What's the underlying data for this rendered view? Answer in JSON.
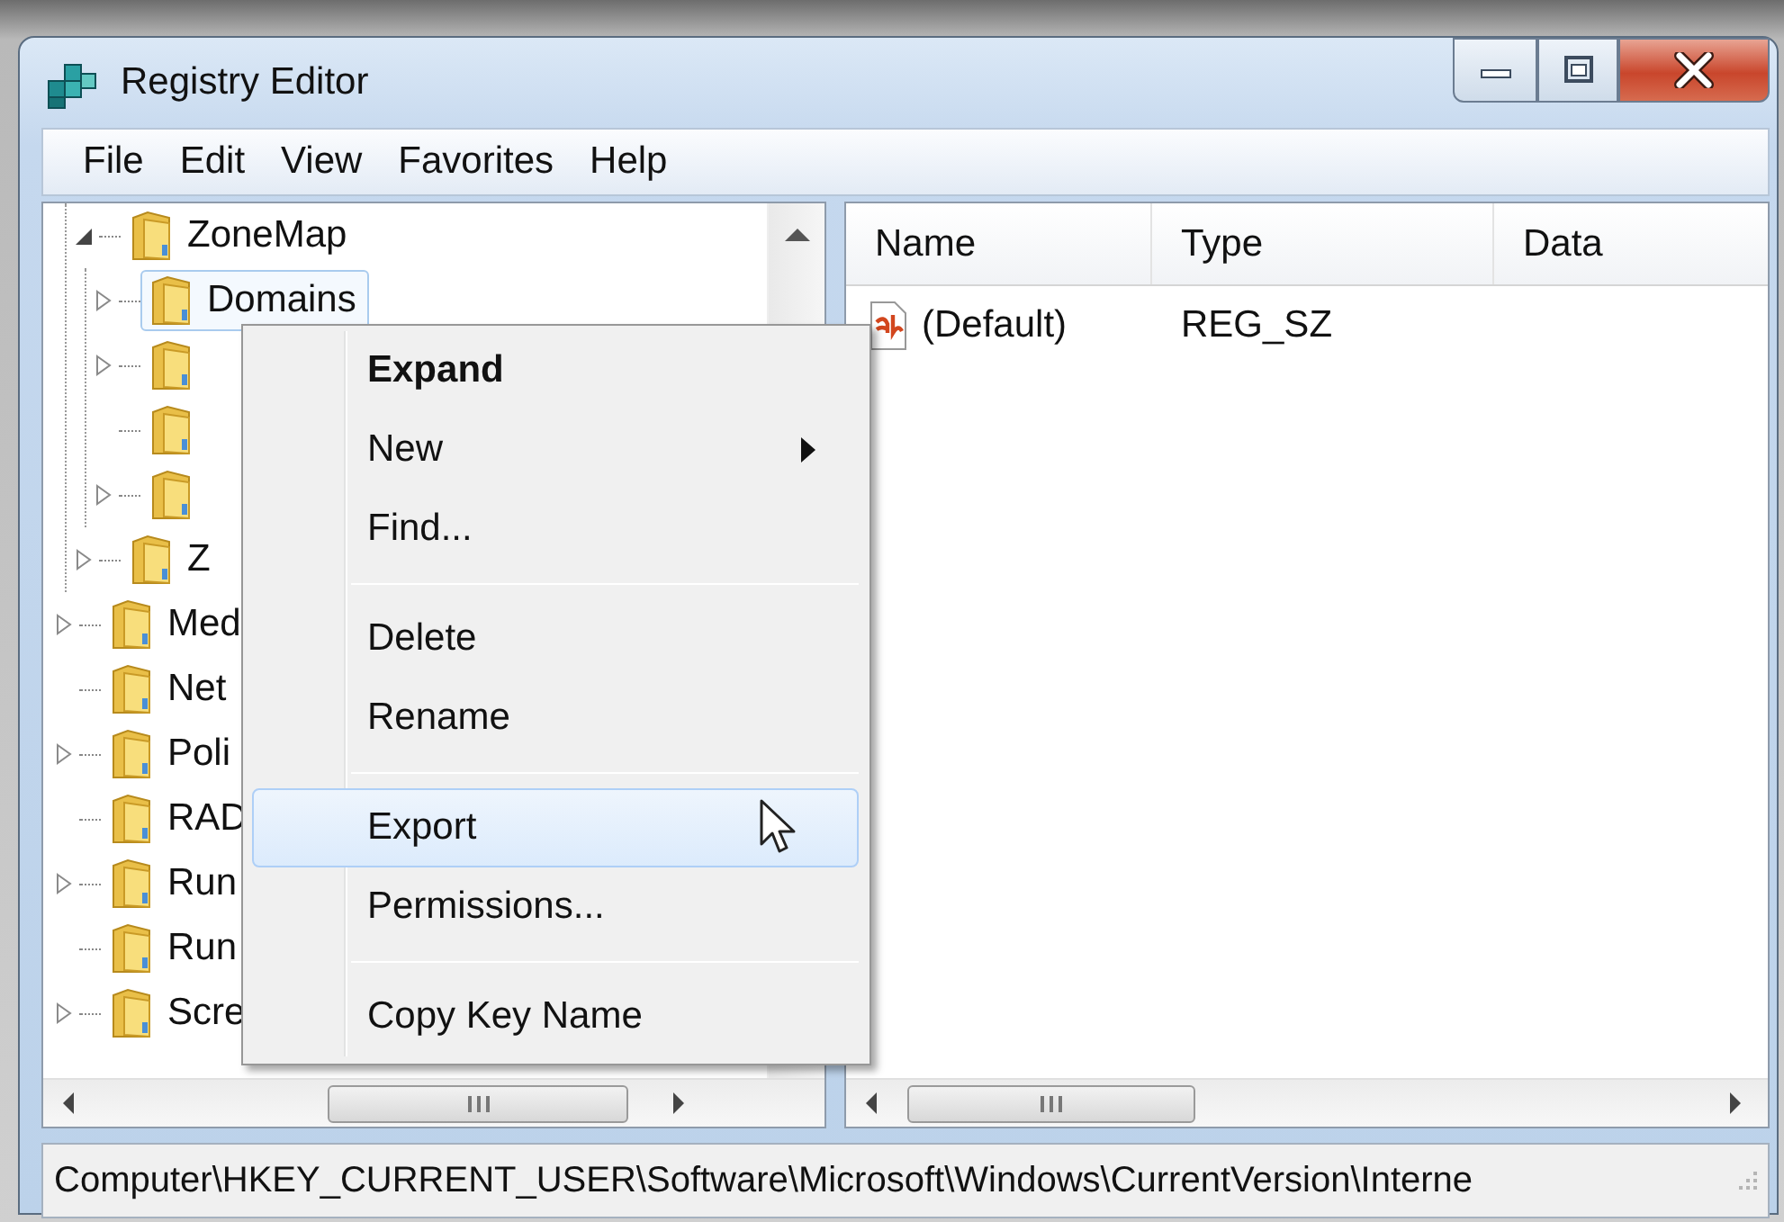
{
  "window": {
    "title": "Registry Editor"
  },
  "menu_bar": [
    "File",
    "Edit",
    "View",
    "Favorites",
    "Help"
  ],
  "tree": [
    {
      "kind": "offscreen",
      "children": [
        {
          "kind": "key",
          "label": "ZoneMap",
          "expanded": true,
          "selected": false,
          "children": [
            {
              "kind": "key",
              "label": "Domains",
              "expanded": false,
              "selected": true
            },
            {
              "kind": "key",
              "expanded": false,
              "selected": false
            },
            {
              "kind": "leaf",
              "selected": false
            },
            {
              "kind": "key",
              "expanded": false,
              "selected": false
            }
          ]
        },
        {
          "kind": "key",
          "label": "Z",
          "expanded": false,
          "selected": false
        }
      ]
    },
    {
      "kind": "key",
      "label": "Med",
      "expanded": false,
      "selected": false
    },
    {
      "kind": "leaf",
      "label": "Net",
      "selected": false
    },
    {
      "kind": "key",
      "label": "Poli",
      "expanded": false,
      "selected": false
    },
    {
      "kind": "leaf",
      "label": "RAD",
      "selected": false
    },
    {
      "kind": "key",
      "label": "Run",
      "expanded": false,
      "selected": false
    },
    {
      "kind": "leaf",
      "label": "Run",
      "selected": false
    },
    {
      "kind": "key",
      "label": "Scre",
      "expanded": false,
      "selected": false
    }
  ],
  "values": {
    "columns": [
      "Name",
      "Type",
      "Data"
    ],
    "rows": [
      {
        "name": "(Default)",
        "type": "REG_SZ"
      }
    ]
  },
  "context_menu": [
    {
      "kind": "item",
      "label": "Expand",
      "default": true,
      "submenu": false,
      "selected": false
    },
    {
      "kind": "item",
      "label": "New",
      "default": false,
      "submenu": true,
      "selected": false
    },
    {
      "kind": "item",
      "label": "Find...",
      "default": false,
      "submenu": false,
      "selected": false
    },
    {
      "kind": "separator"
    },
    {
      "kind": "item",
      "label": "Delete",
      "default": false,
      "submenu": false,
      "selected": false
    },
    {
      "kind": "item",
      "label": "Rename",
      "default": false,
      "submenu": false,
      "selected": false
    },
    {
      "kind": "separator"
    },
    {
      "kind": "item",
      "label": "Export",
      "default": false,
      "submenu": false,
      "selected": true
    },
    {
      "kind": "item",
      "label": "Permissions...",
      "default": false,
      "submenu": false,
      "selected": false
    },
    {
      "kind": "separator"
    },
    {
      "kind": "item",
      "label": "Copy Key Name",
      "default": false,
      "submenu": false,
      "selected": false
    }
  ],
  "status_bar": "Computer\\HKEY_CURRENT_USER\\Software\\Microsoft\\Windows\\CurrentVersion\\Interne"
}
